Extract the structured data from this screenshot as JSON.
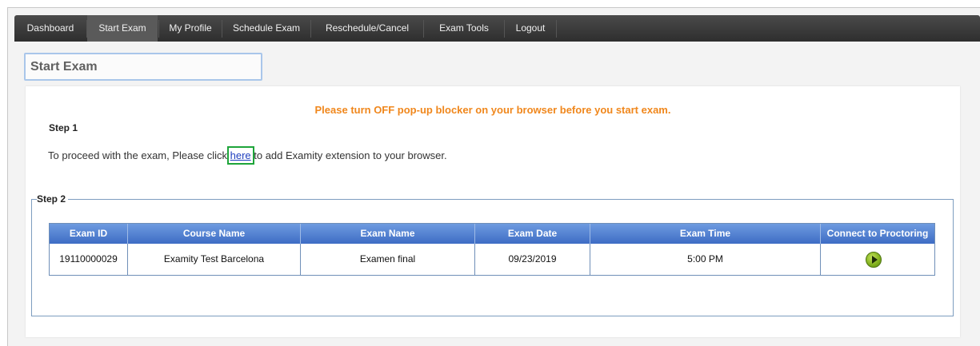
{
  "nav": {
    "items": [
      {
        "label": "Dashboard"
      },
      {
        "label": "Start Exam"
      },
      {
        "label": "My Profile"
      },
      {
        "label": "Schedule Exam"
      },
      {
        "label": "Reschedule/Cancel"
      },
      {
        "label": "Exam Tools"
      },
      {
        "label": "Logout"
      }
    ],
    "active": "Start Exam"
  },
  "page": {
    "title": "Start Exam",
    "warning": "Please turn OFF pop-up blocker on your browser before you start exam."
  },
  "step1": {
    "heading": "Step 1",
    "text_before": "To proceed with the exam, Please click ",
    "link": "here",
    "text_after": " to add Examity extension to your browser."
  },
  "step2": {
    "heading": "Step 2",
    "columns": [
      "Exam ID",
      "Course Name",
      "Exam Name",
      "Exam Date",
      "Exam Time",
      "Connect to Proctoring"
    ],
    "rows": [
      {
        "exam_id": "19110000029",
        "course_name": "Examity Test Barcelona",
        "exam_name": "Examen final",
        "exam_date": "09/23/2019",
        "exam_time": "5:00 PM",
        "action_icon": "play-icon"
      }
    ]
  },
  "colors": {
    "navbar": "#3a3a3a",
    "warning": "#f0871c",
    "table_header": "#4a78c9",
    "link": "#1f3fbf",
    "link_highlight": "#1ea53a",
    "play_button": "#7fae1c"
  }
}
